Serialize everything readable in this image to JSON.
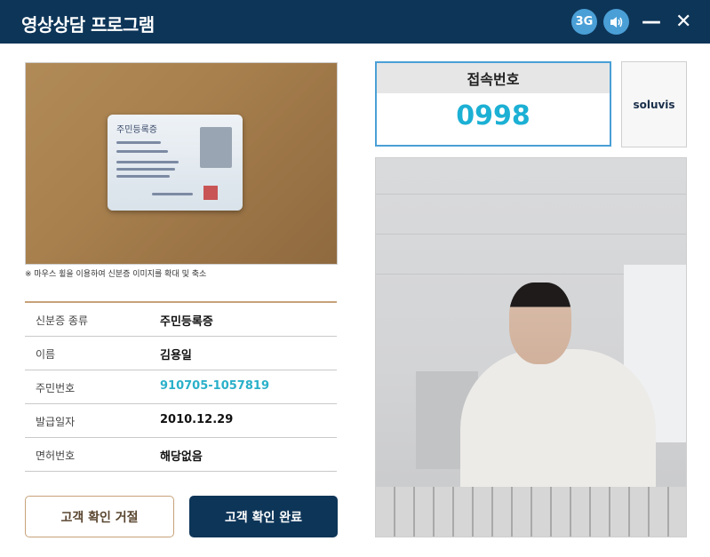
{
  "window": {
    "title": "영상상담 프로그램",
    "network_badge": "3G",
    "speaker_icon": "speaker-icon",
    "minimize_symbol": "—",
    "close_symbol": "✕"
  },
  "id_image": {
    "notice": "※ 마우스 휠을 이용하여 신분증 이미지를 확대 및 축소",
    "card_title": "주민등록증"
  },
  "customer_info": [
    {
      "label": "신분증 종류",
      "value": "주민등록증"
    },
    {
      "label": "이름",
      "value": "김용일"
    },
    {
      "label": "주민번호",
      "value": "910705-1057819"
    },
    {
      "label": "발급일자",
      "value": "2010.12.29"
    },
    {
      "label": "면허번호",
      "value": "해당없음"
    }
  ],
  "buttons": {
    "reject": "고객 확인 거절",
    "confirm": "고객 확인 완료"
  },
  "access": {
    "label": "접속번호",
    "number": "0998"
  },
  "brand": "soluvis",
  "colors": {
    "titlebar": "#0d3558",
    "accent_blue": "#4a9fd6",
    "number_cyan": "#1cb0d4",
    "border_tan": "#c7a27a"
  }
}
